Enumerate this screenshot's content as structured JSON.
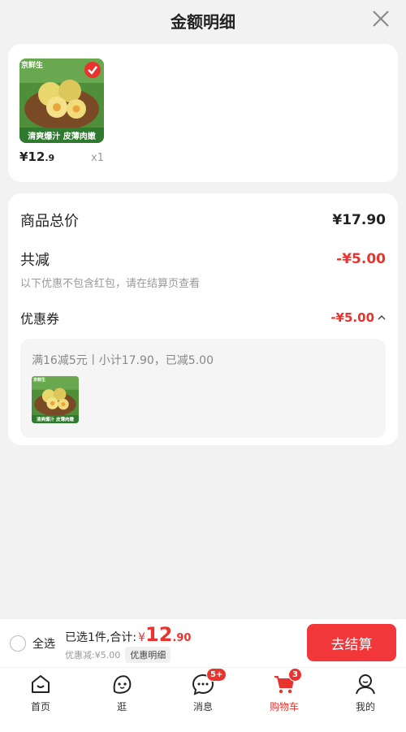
{
  "header": {
    "title": "金额明细",
    "close_icon": "close-icon"
  },
  "product": {
    "image_brand": "京鲜生",
    "image_caption": "清爽爆汁 皮薄肉嫩",
    "price_int": "¥12",
    "price_dec": ".9",
    "quantity": "x1"
  },
  "breakdown": {
    "total_label": "商品总价",
    "total_value": "¥17.90",
    "reduce_label": "共减",
    "reduce_value": "-¥5.00",
    "note": "以下优惠不包含红包，请在结算页查看",
    "coupon_label": "优惠券",
    "coupon_value": "-¥5.00",
    "coupon_detail": "满16减5元丨小计17.90，已减5.00"
  },
  "bottom_bar": {
    "select_all": "全选",
    "selected_text": "已选1件,合计:",
    "currency": "¥",
    "total_int": "12",
    "total_dec": ".90",
    "discount": "优惠减:¥5.00",
    "detail_button": "优惠明细",
    "checkout": "去结算"
  },
  "tabs": [
    {
      "label": "首页",
      "icon": "home-icon"
    },
    {
      "label": "逛",
      "icon": "browse-icon"
    },
    {
      "label": "消息",
      "icon": "message-icon",
      "badge": "5+"
    },
    {
      "label": "购物车",
      "icon": "cart-icon",
      "badge": "3",
      "active": true
    },
    {
      "label": "我的",
      "icon": "profile-icon"
    }
  ],
  "colors": {
    "accent": "#e8332e",
    "checkout_bg": "#f2373b",
    "background": "#f2f2f2"
  }
}
